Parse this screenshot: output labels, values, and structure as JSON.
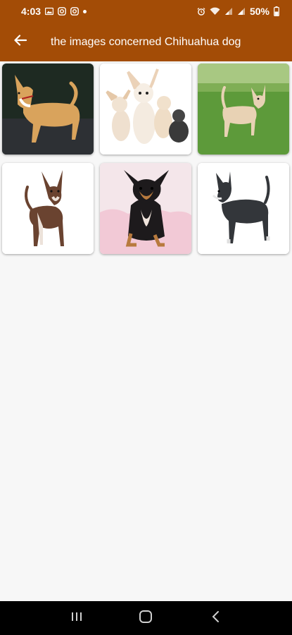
{
  "status_bar": {
    "time": "4:03",
    "battery_percent": "50%",
    "icons": [
      "gallery-icon",
      "instagram-icon",
      "instagram-icon",
      "dot-icon",
      "alarm-icon",
      "wifi-icon",
      "signal-icon",
      "signal-icon",
      "battery-icon"
    ]
  },
  "app_bar": {
    "title": "the images concerned Chihuahua dog",
    "back_icon": "arrow-left-icon",
    "color": "#a34c06"
  },
  "gallery": {
    "items": [
      {
        "name": "chihuahua-image-1"
      },
      {
        "name": "chihuahua-image-2"
      },
      {
        "name": "chihuahua-image-3"
      },
      {
        "name": "chihuahua-image-4"
      },
      {
        "name": "chihuahua-image-5"
      },
      {
        "name": "chihuahua-image-6"
      }
    ]
  },
  "nav_bar": {
    "buttons": [
      "recent-apps-icon",
      "home-icon",
      "back-icon"
    ]
  }
}
